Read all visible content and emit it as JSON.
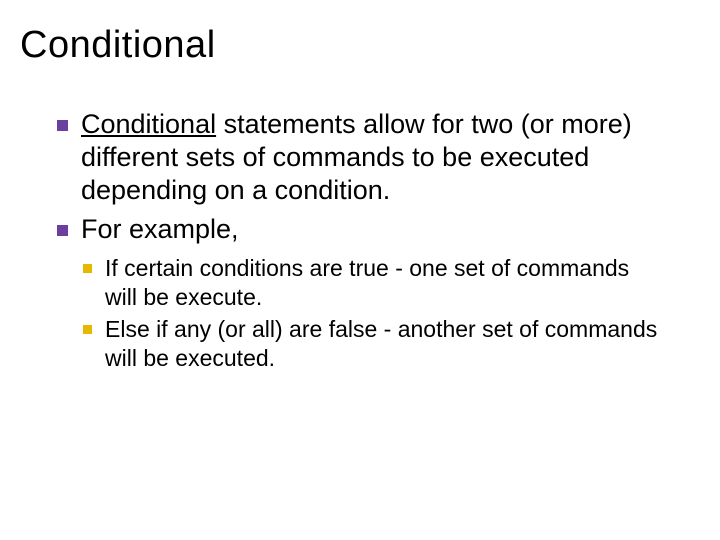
{
  "title": "Conditional",
  "bullets": [
    {
      "underlined": "Conditional",
      "rest": " statements allow for two (or more) different sets of commands to be executed depending on a condition."
    },
    {
      "text": "For example,",
      "sub": [
        {
          "text": "If certain conditions are true - one set of commands will be execute."
        },
        {
          "text": "Else if any (or all) are false - another set of commands will be executed."
        }
      ]
    }
  ]
}
